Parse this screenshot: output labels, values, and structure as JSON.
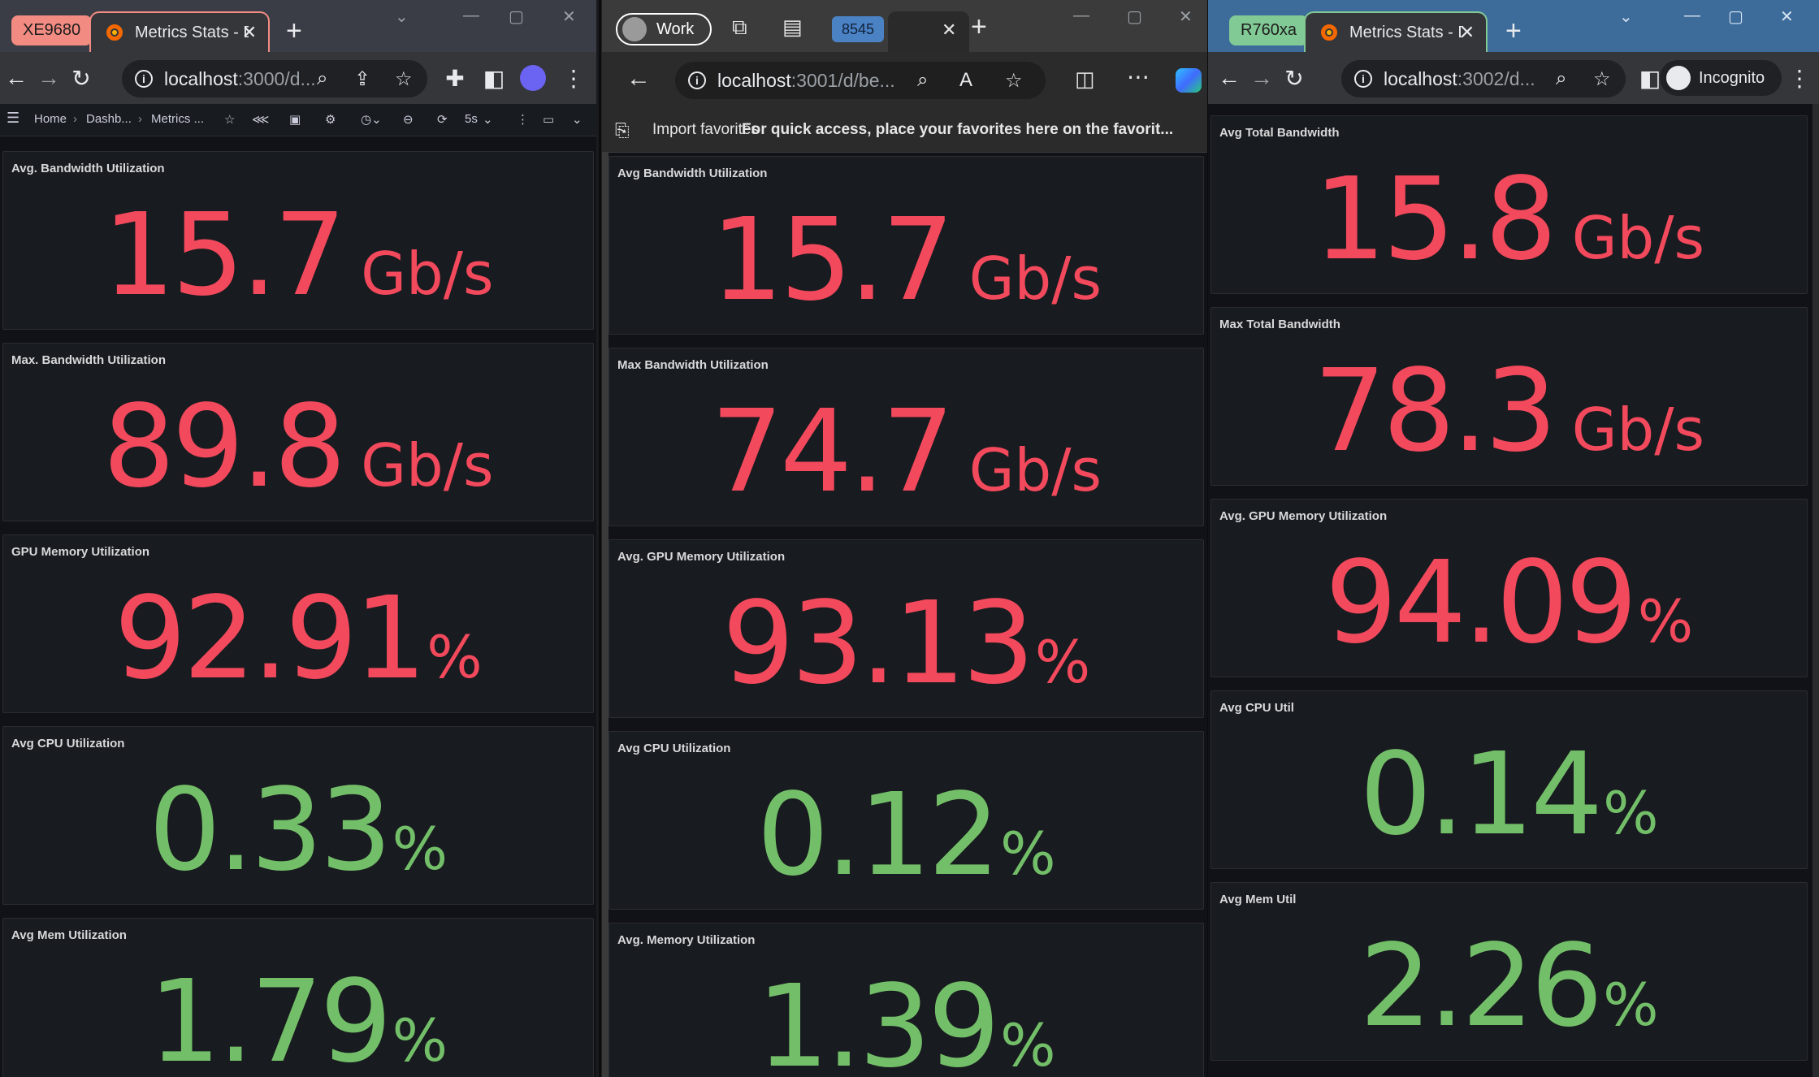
{
  "colors": {
    "critical": "#f2495c",
    "ok": "#73bf69",
    "panel_bg": "#181b1f"
  },
  "window1": {
    "group_label": "XE9680",
    "tab_title": "Metrics Stats - D",
    "url_host": "localhost",
    "url_rest": ":3000/d...",
    "breadcrumb": [
      "Home",
      "Dashb...",
      "Metrics ..."
    ],
    "refresh_interval": "5s",
    "panels": [
      {
        "title": "Avg. Bandwidth Utilization",
        "value": "15.7",
        "unit": "Gb/s",
        "status": "critical"
      },
      {
        "title": "Max. Bandwidth Utilization",
        "value": "89.8",
        "unit": "Gb/s",
        "status": "critical"
      },
      {
        "title": "GPU Memory Utilization",
        "value": "92.91",
        "unit": "%",
        "status": "critical"
      },
      {
        "title": "Avg CPU Utilization",
        "value": "0.33",
        "unit": "%",
        "status": "ok"
      },
      {
        "title": "Avg Mem Utilization",
        "value": "1.79",
        "unit": "%",
        "status": "ok"
      }
    ]
  },
  "window2": {
    "profile_label": "Work",
    "group_label": "8545",
    "url_host": "localhost",
    "url_rest": ":3001/d/be...",
    "favorites_import": "Import favorites",
    "favorites_hint": "For quick access, place your favorites here on the favorit...",
    "panels": [
      {
        "title": "Avg Bandwidth Utilization",
        "value": "15.7",
        "unit": "Gb/s",
        "status": "critical"
      },
      {
        "title": "Max Bandwidth Utilization",
        "value": "74.7",
        "unit": "Gb/s",
        "status": "critical"
      },
      {
        "title": "Avg. GPU Memory Utilization",
        "value": "93.13",
        "unit": "%",
        "status": "critical"
      },
      {
        "title": "Avg CPU Utilization",
        "value": "0.12",
        "unit": "%",
        "status": "ok"
      },
      {
        "title": "Avg. Memory Utilization",
        "value": "1.39",
        "unit": "%",
        "status": "ok"
      }
    ]
  },
  "window3": {
    "group_label": "R760xa",
    "tab_title": "Metrics Stats - D",
    "url_host": "localhost",
    "url_rest": ":3002/d...",
    "incognito_label": "Incognito",
    "panels": [
      {
        "title": "Avg Total Bandwidth",
        "value": "15.8",
        "unit": "Gb/s",
        "status": "critical"
      },
      {
        "title": "Max Total Bandwidth",
        "value": "78.3",
        "unit": "Gb/s",
        "status": "critical"
      },
      {
        "title": "Avg. GPU Memory Utilization",
        "value": "94.09",
        "unit": "%",
        "status": "critical"
      },
      {
        "title": "Avg CPU Util",
        "value": "0.14",
        "unit": "%",
        "status": "ok"
      },
      {
        "title": "Avg Mem Util",
        "value": "2.26",
        "unit": "%",
        "status": "ok"
      }
    ]
  }
}
